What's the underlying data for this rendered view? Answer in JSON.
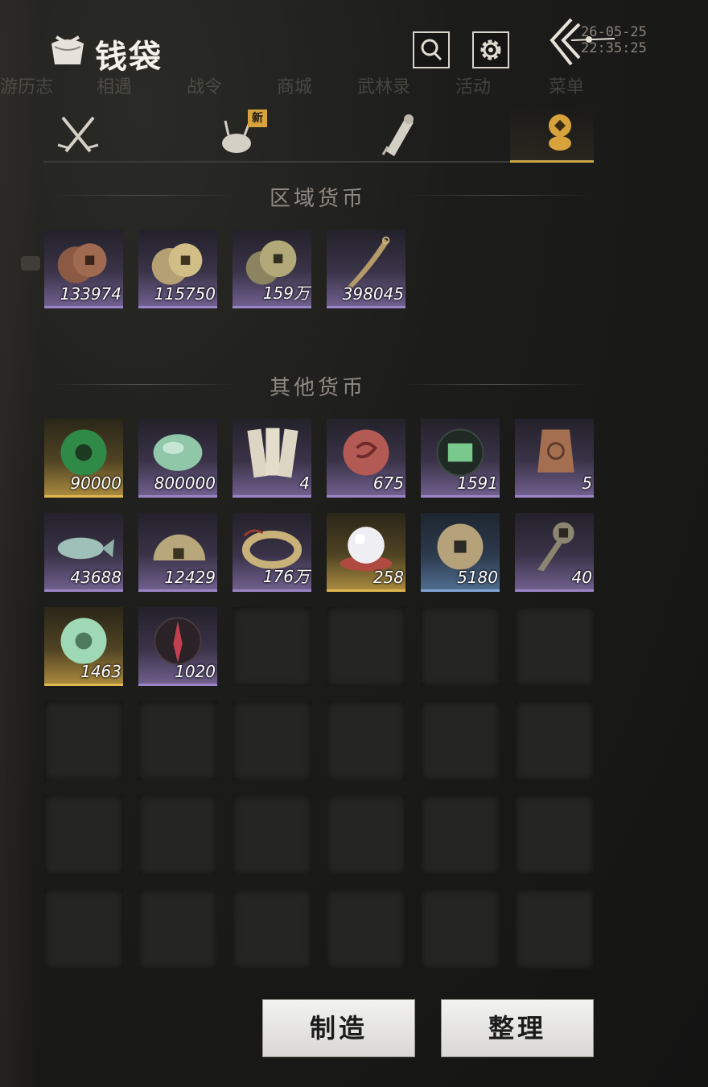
{
  "background_menu": {
    "items": [
      "游历志",
      "相遇",
      "战令",
      "商城",
      "武林录",
      "活动",
      "菜单"
    ],
    "datetime": "26-05-25 22:35:25"
  },
  "header": {
    "title": "钱袋",
    "title_icon": "money-pouch-icon",
    "search_icon": "search-icon",
    "settings_icon": "gear-icon",
    "back_icon": "back-chevron-icon"
  },
  "tabs": [
    {
      "icon": "crossed-swords-icon",
      "active": false,
      "badge": ""
    },
    {
      "icon": "bundle-sack-icon",
      "active": false,
      "badge": "新"
    },
    {
      "icon": "scroll-icon",
      "active": false,
      "badge": ""
    },
    {
      "icon": "coin-stack-icon",
      "active": true,
      "badge": ""
    }
  ],
  "sections": {
    "regional": "区域货币",
    "other": "其他货币"
  },
  "regional_currency": [
    {
      "icon": "copper-coins-icon",
      "qty": "133974",
      "rarity": "purple"
    },
    {
      "icon": "silver-coins-icon",
      "qty": "115750",
      "rarity": "purple"
    },
    {
      "icon": "bronze-coins-icon",
      "qty": "159万",
      "rarity": "purple"
    },
    {
      "icon": "curved-blade-icon",
      "qty": "398045",
      "rarity": "purple"
    }
  ],
  "other_currency": [
    {
      "icon": "green-jade-disc-icon",
      "qty": "90000",
      "rarity": "gold"
    },
    {
      "icon": "jade-stone-icon",
      "qty": "800000",
      "rarity": "purple"
    },
    {
      "icon": "paper-notes-icon",
      "qty": "4",
      "rarity": "purple"
    },
    {
      "icon": "red-seal-token-icon",
      "qty": "675",
      "rarity": "purple"
    },
    {
      "icon": "map-emblem-icon",
      "qty": "1591",
      "rarity": "purple"
    },
    {
      "icon": "bronze-plaque-icon",
      "qty": "5",
      "rarity": "purple"
    },
    {
      "icon": "jade-fish-icon",
      "qty": "43688",
      "rarity": "purple"
    },
    {
      "icon": "half-coin-icon",
      "qty": "12429",
      "rarity": "purple"
    },
    {
      "icon": "coin-string-icon",
      "qty": "176万",
      "rarity": "purple"
    },
    {
      "icon": "pearl-icon",
      "qty": "258",
      "rarity": "gold"
    },
    {
      "icon": "ancient-coin-icon",
      "qty": "5180",
      "rarity": "blue"
    },
    {
      "icon": "key-coin-icon",
      "qty": "40",
      "rarity": "purple"
    },
    {
      "icon": "pale-jade-disc-icon",
      "qty": "1463",
      "rarity": "gold"
    },
    {
      "icon": "crimson-sigil-icon",
      "qty": "1020",
      "rarity": "purple"
    }
  ],
  "buttons": {
    "craft": "制造",
    "sort": "整理"
  }
}
